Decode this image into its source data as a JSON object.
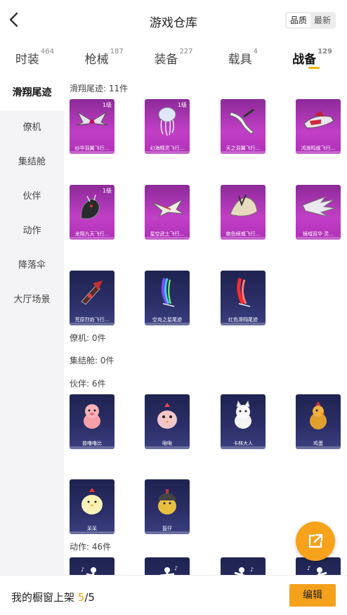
{
  "header": {
    "title": "游戏仓库",
    "sort": [
      "品质",
      "最新"
    ]
  },
  "tabs": [
    {
      "label": "时装",
      "count": "464"
    },
    {
      "label": "枪械",
      "count": "187"
    },
    {
      "label": "装备",
      "count": "227"
    },
    {
      "label": "载具",
      "count": "4"
    },
    {
      "label": "战备",
      "count": "129"
    }
  ],
  "sidebar": [
    "滑翔尾迹",
    "僚机",
    "集结舱",
    "伙伴",
    "动作",
    "降落伞",
    "大厅场景"
  ],
  "sections": {
    "trail": "滑翔尾迹: 11件",
    "wing": "僚机: 0件",
    "pod": "集结舱: 0件",
    "pet": "伙伴: 6件",
    "emote": "动作: 46件"
  },
  "trail_items": [
    {
      "name": "纱华羽翼飞行...",
      "level": "1级"
    },
    {
      "name": "幻海精灵飞行...",
      "level": "1级"
    },
    {
      "name": "天之羽翼飞行...",
      "level": ""
    },
    {
      "name": "鸿渐鸣舰飞行...",
      "level": ""
    },
    {
      "name": "龙翔九天飞行...",
      "level": "1级"
    },
    {
      "name": "星空武士飞行...",
      "level": ""
    },
    {
      "name": "绝色倾城飞行...",
      "level": ""
    },
    {
      "name": "镜域双华·灵...",
      "level": ""
    },
    {
      "name": "荒原烈焰飞行...",
      "level": ""
    },
    {
      "name": "空岛之星尾迹",
      "level": ""
    },
    {
      "name": "红色滑翔尾迹",
      "level": ""
    }
  ],
  "pet_items": [
    {
      "name": "普噜噜比"
    },
    {
      "name": "啾啾"
    },
    {
      "name": "卡林大人"
    },
    {
      "name": "鸡蛋"
    },
    {
      "name": "呆呆"
    },
    {
      "name": "盔仔"
    }
  ],
  "bottom": {
    "label": "我的橱窗上架",
    "current": "5",
    "total": "/5",
    "edit": "编辑"
  }
}
